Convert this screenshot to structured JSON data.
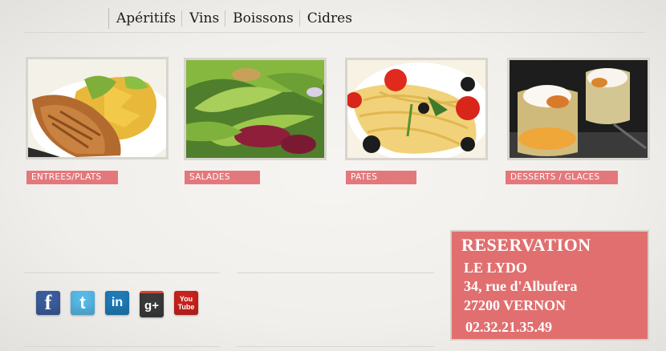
{
  "nav": {
    "items": [
      {
        "label": "Apéritifs"
      },
      {
        "label": "Vins"
      },
      {
        "label": "Boissons"
      },
      {
        "label": "Cidres"
      }
    ]
  },
  "categories": [
    {
      "label": "ENTREES/PLATS"
    },
    {
      "label": "SALADES"
    },
    {
      "label": "PATES"
    },
    {
      "label": "DESSERTS / GLACES"
    }
  ],
  "social": [
    {
      "name": "facebook",
      "glyph": "f",
      "color": "#3b5c9c"
    },
    {
      "name": "twitter",
      "glyph": "t",
      "color": "#56b8e6"
    },
    {
      "name": "linkedin",
      "glyph": "in",
      "color": "#1f7bb6"
    },
    {
      "name": "google-plus",
      "glyph": "g+",
      "color": "#3a3a3a"
    },
    {
      "name": "youtube",
      "glyph": "You Tube",
      "color": "#c9221c"
    }
  ],
  "reservation": {
    "title": "RESERVATION",
    "name": "LE LYDO",
    "street": "34, rue d'Albufera",
    "city": "27200  VERNON",
    "phone": "02.32.21.35.49"
  }
}
